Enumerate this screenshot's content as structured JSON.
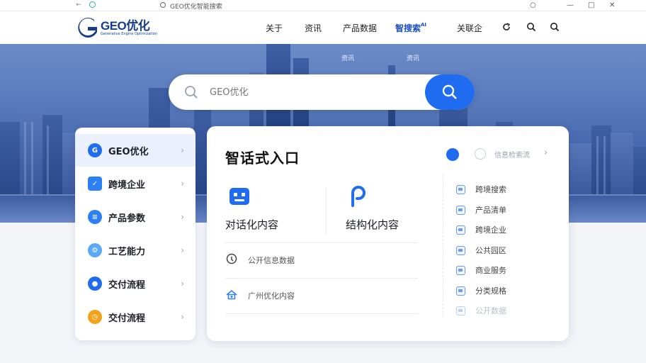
{
  "browser": {
    "address": "GEO优化智能搜索"
  },
  "header": {
    "logo_text": "GEO优化",
    "logo_subtext": "Generative Engine Optimization",
    "nav": [
      {
        "label": "关于"
      },
      {
        "label": "资讯"
      },
      {
        "label": "产品数据"
      },
      {
        "label": "智搜索",
        "sup": "AI"
      },
      {
        "label": "关联企"
      }
    ]
  },
  "hero": {
    "labels": [
      "资讯",
      "资讯"
    ],
    "search": {
      "placeholder": "GEO优化"
    }
  },
  "sidebar": {
    "items": [
      {
        "label": "GEO优化",
        "color": "#1f6cf0"
      },
      {
        "label": "跨境企业",
        "color": "#2d7ff5"
      },
      {
        "label": "产品参数",
        "color": "#2d7ff5"
      },
      {
        "label": "工艺能力",
        "color": "#5aa9f5"
      },
      {
        "label": "交付流程",
        "color": "#1f6cf0"
      },
      {
        "label": "交付流程",
        "color": "#f3a21a"
      }
    ]
  },
  "card": {
    "title": "智话式入口",
    "top_link": "信息检索流",
    "features": [
      {
        "label": "对话化内容"
      },
      {
        "label": "结构化内容"
      }
    ],
    "rows": [
      {
        "label": "公开信息数据"
      },
      {
        "label": "广州优化内容"
      }
    ],
    "list": [
      {
        "label": "跨境搜索"
      },
      {
        "label": "产品清单"
      },
      {
        "label": "跨境企业"
      },
      {
        "label": "公共园区"
      },
      {
        "label": "商业服务"
      },
      {
        "label": "分类规格"
      },
      {
        "label": "公开数据"
      }
    ]
  },
  "colors": {
    "accent": "#1f6cf0",
    "brand": "#163c8c"
  }
}
